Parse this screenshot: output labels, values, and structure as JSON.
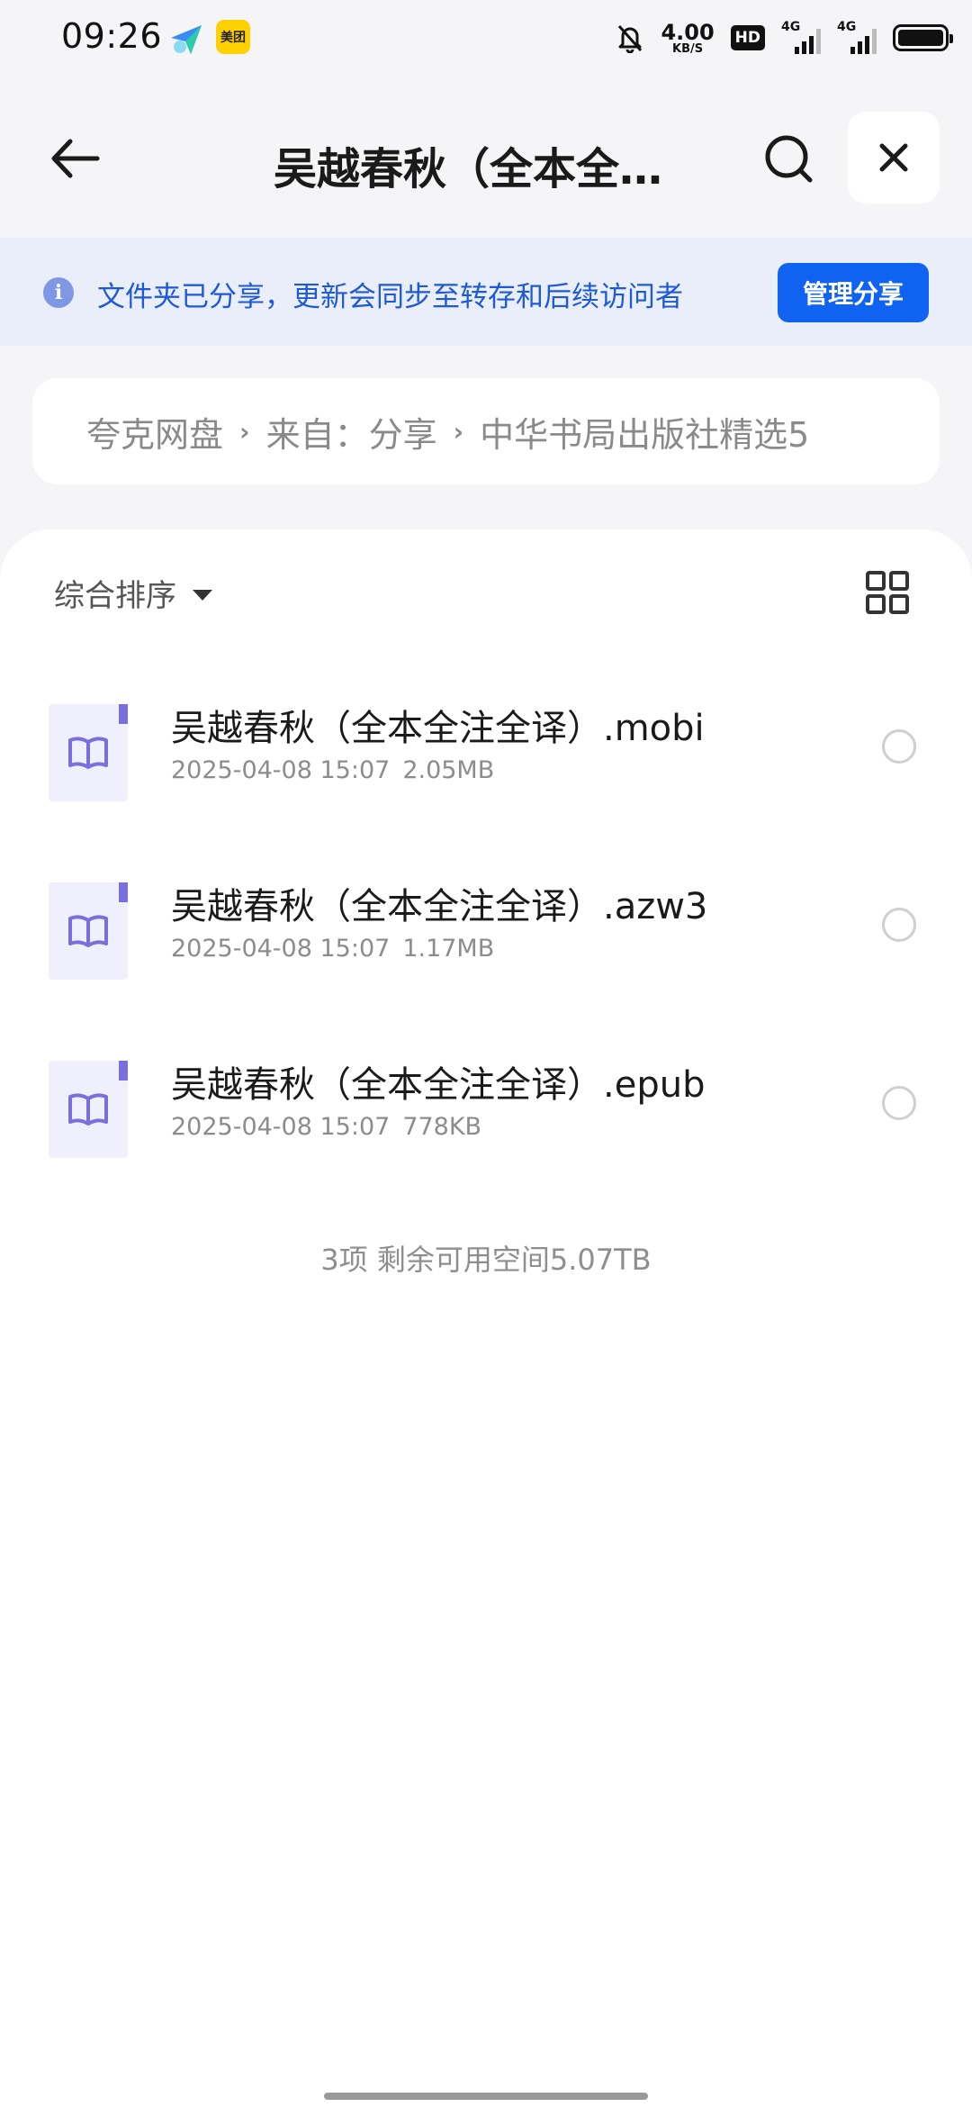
{
  "status_bar": {
    "time": "09:26",
    "meituan_label": "美团",
    "net_speed_value": "4.00",
    "net_speed_unit": "KB/S",
    "hd_label": "HD",
    "signal1_label": "4G",
    "signal2_label": "4G"
  },
  "header": {
    "title": "吴越春秋（全本全…"
  },
  "notice": {
    "info_glyph": "i",
    "text": "文件夹已分享，更新会同步至转存和后续访问者",
    "manage_label": "管理分享"
  },
  "breadcrumb": {
    "items": [
      "夸克网盘",
      "来自：分享",
      "中华书局出版社精选5"
    ],
    "separator": "›"
  },
  "toolbar": {
    "sort_label": "综合排序"
  },
  "files": [
    {
      "name": "吴越春秋（全本全注全译）.mobi",
      "date": "2025-04-08 15:07",
      "size": "2.05MB"
    },
    {
      "name": "吴越春秋（全本全注全译）.azw3",
      "date": "2025-04-08 15:07",
      "size": "1.17MB"
    },
    {
      "name": "吴越春秋（全本全注全译）.epub",
      "date": "2025-04-08 15:07",
      "size": "778KB"
    }
  ],
  "footer": {
    "count_text": "3项 剩余可用空间5.07TB"
  },
  "colors": {
    "accent": "#1062f0",
    "notice_bg": "#e9eef9",
    "notice_text": "#1e5ad8",
    "file_icon_accent": "#7a6fdc"
  }
}
